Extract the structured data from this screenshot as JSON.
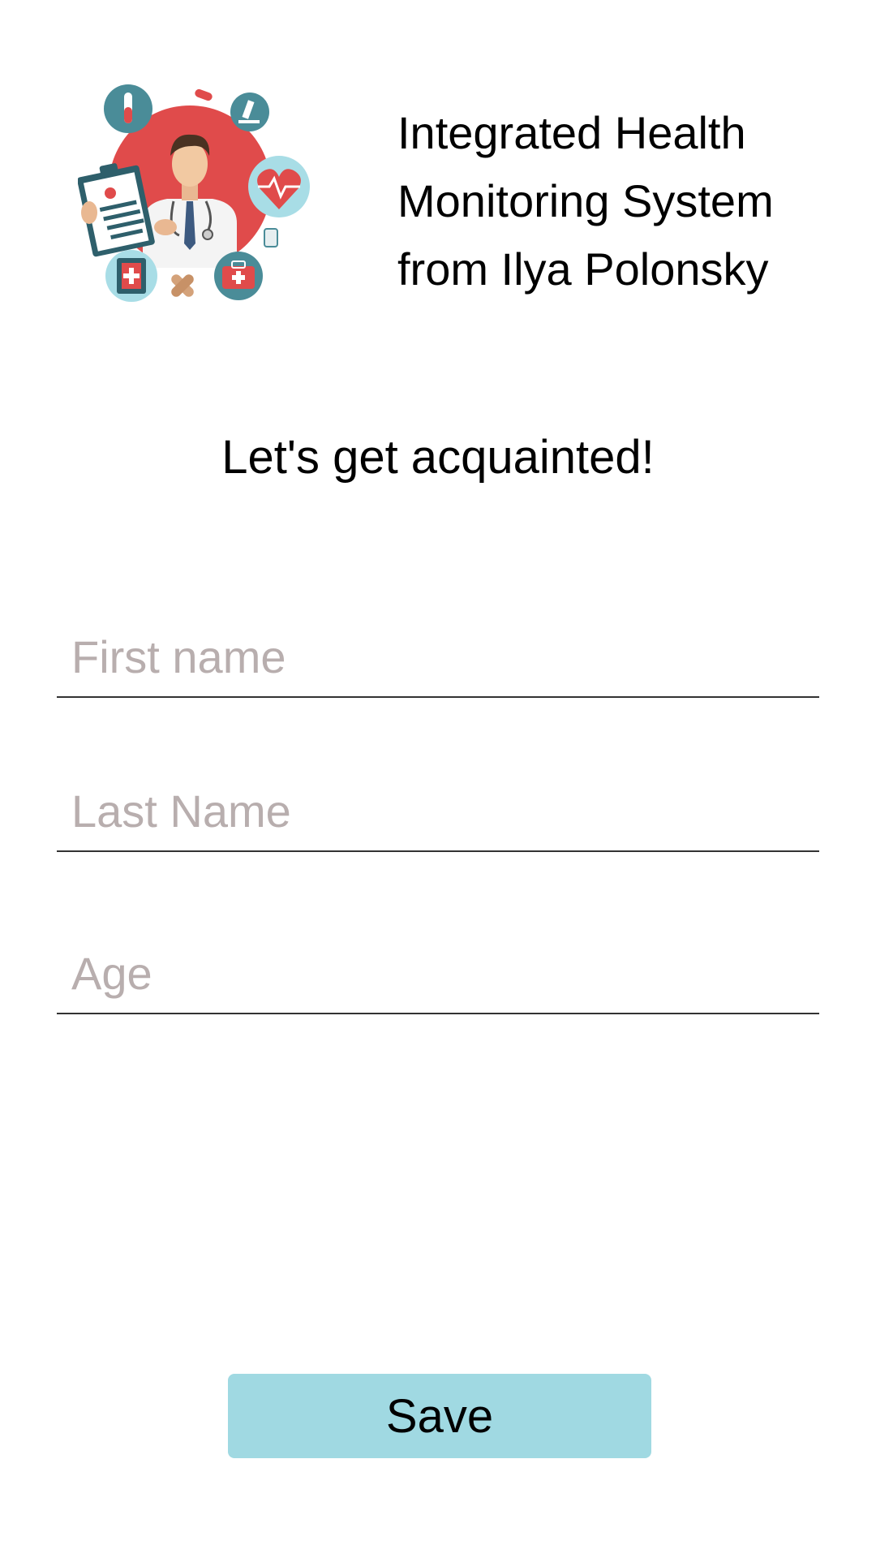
{
  "header": {
    "logo": "doctor-illustration",
    "title_lines": [
      "Integrated Health",
      "Monitoring System",
      "from Ilya Polonsky"
    ]
  },
  "greeting": "Let's get acquainted!",
  "form": {
    "first_name": {
      "placeholder": "First name",
      "value": ""
    },
    "last_name": {
      "placeholder": "Last Name",
      "value": ""
    },
    "age": {
      "placeholder": "Age",
      "value": ""
    }
  },
  "save_label": "Save",
  "colors": {
    "button_bg": "#a0d9e2",
    "placeholder": "#b8aeae",
    "logo_red": "#e04b4b",
    "logo_teal": "#4a8c98",
    "logo_lightblue": "#a8dde6"
  }
}
